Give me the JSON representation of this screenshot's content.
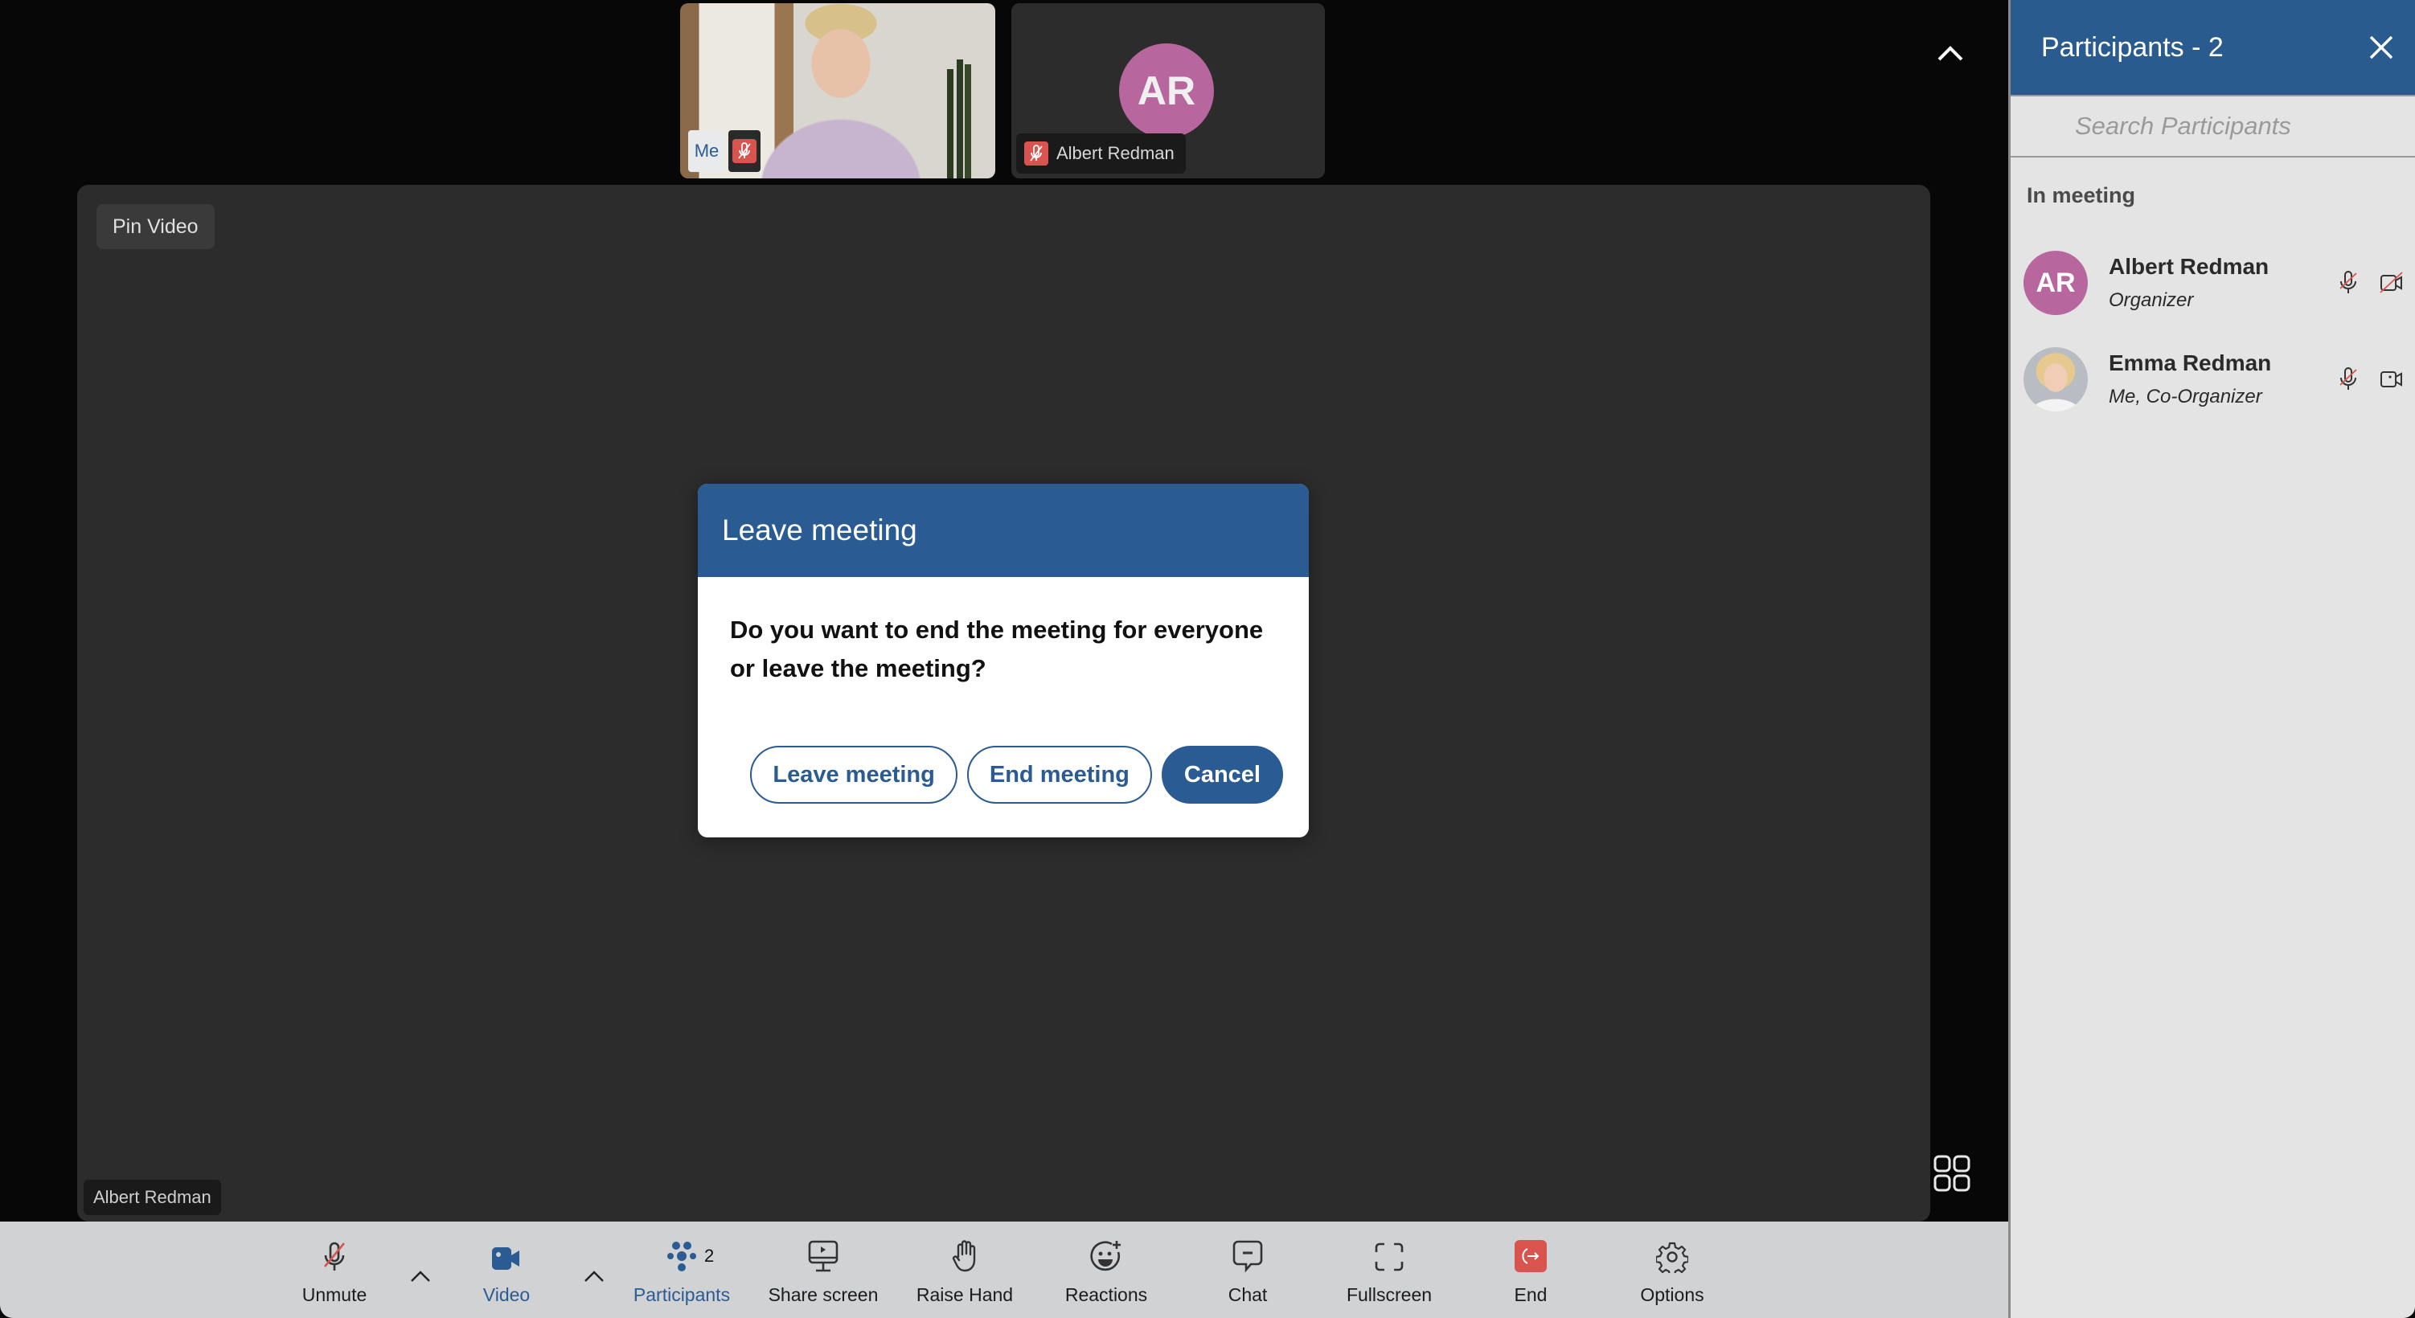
{
  "thumbnails": {
    "me": {
      "tag": "Me",
      "mic_state": "muted"
    },
    "other": {
      "initials": "AR",
      "name": "Albert Redman",
      "mic_state": "muted",
      "avatar_color": "#b8679e"
    }
  },
  "main_video": {
    "pin_label": "Pin Video",
    "speaker_name": "Albert Redman",
    "avatar_color": "#b8679e"
  },
  "toolbar": {
    "items": [
      {
        "id": "unmute",
        "label": "Unmute",
        "icon": "mic-off-icon",
        "active": false
      },
      {
        "id": "video",
        "label": "Video",
        "icon": "video-camera-icon",
        "active": true
      },
      {
        "id": "participants",
        "label": "Participants",
        "icon": "participants-icon",
        "count": "2",
        "active": true
      },
      {
        "id": "share-screen",
        "label": "Share screen",
        "icon": "share-screen-icon",
        "active": false
      },
      {
        "id": "raise-hand",
        "label": "Raise Hand",
        "icon": "hand-icon",
        "active": false
      },
      {
        "id": "reactions",
        "label": "Reactions",
        "icon": "emoji-add-icon",
        "active": false
      },
      {
        "id": "chat",
        "label": "Chat",
        "icon": "chat-icon",
        "active": false
      },
      {
        "id": "fullscreen",
        "label": "Fullscreen",
        "icon": "fullscreen-icon",
        "active": false
      },
      {
        "id": "end",
        "label": "End",
        "icon": "leave-icon",
        "active": false
      },
      {
        "id": "options",
        "label": "Options",
        "icon": "gear-icon",
        "active": false
      }
    ]
  },
  "sidebar": {
    "title": "Participants - 2",
    "search_placeholder": "Search Participants",
    "section_label": "In meeting",
    "participants": [
      {
        "name": "Albert Redman",
        "role": "Organizer",
        "initials": "AR",
        "mic": "muted",
        "video": "off"
      },
      {
        "name": "Emma Redman",
        "role": "Me, Co-Organizer",
        "initials": "",
        "mic": "muted",
        "video": "on"
      }
    ]
  },
  "dialog": {
    "title": "Leave meeting",
    "message": "Do you want to end the meeting for everyone or leave the meeting?",
    "buttons": {
      "leave": "Leave meeting",
      "end": "End meeting",
      "cancel": "Cancel"
    }
  },
  "colors": {
    "brand_blue": "#2a5b93",
    "danger_red": "#d9534f",
    "avatar_pink": "#b8679e"
  }
}
